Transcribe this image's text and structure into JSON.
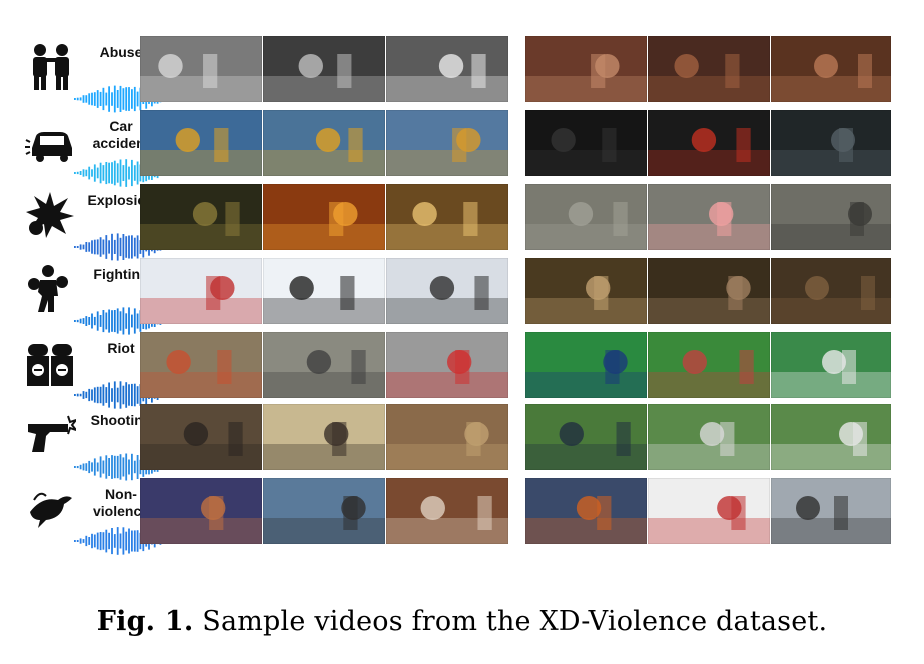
{
  "figure": {
    "rows": [
      {
        "id": "abuse",
        "label": "Abuse",
        "icon": "abuse-icon",
        "wave_color": "#1ea7ff",
        "frames": [
          {
            "bg": "#7a7a7a",
            "accent": "#d8d8d8"
          },
          {
            "bg": "#3d3d3d",
            "accent": "#bfbfbf"
          },
          {
            "bg": "#5b5b5b",
            "accent": "#eaeaea"
          },
          {
            "bg": "#6a3a2a",
            "accent": "#c48b6a"
          },
          {
            "bg": "#4a2a20",
            "accent": "#a06040"
          },
          {
            "bg": "#5a3320",
            "accent": "#b97855"
          }
        ]
      },
      {
        "id": "car-accident",
        "label": "Car accident",
        "icon": "car-crash-icon",
        "wave_color": "#28b7f0",
        "frames": [
          {
            "bg": "#3d6a98",
            "accent": "#e0a020"
          },
          {
            "bg": "#4a7398",
            "accent": "#e0a020"
          },
          {
            "bg": "#5479a0",
            "accent": "#d89a28"
          },
          {
            "bg": "#151515",
            "accent": "#333333"
          },
          {
            "bg": "#1a1a1a",
            "accent": "#c03020"
          },
          {
            "bg": "#202628",
            "accent": "#556066"
          }
        ]
      },
      {
        "id": "explosion",
        "label": "Explosion",
        "icon": "explosion-icon",
        "wave_color": "#2a6fd6",
        "frames": [
          {
            "bg": "#2a2a18",
            "accent": "#8a7a3a"
          },
          {
            "bg": "#8a3a10",
            "accent": "#f0a030"
          },
          {
            "bg": "#6a4a20",
            "accent": "#e8c070"
          },
          {
            "bg": "#7a7a70",
            "accent": "#a0a096"
          },
          {
            "bg": "#7a7a72",
            "accent": "#f0a0a0"
          },
          {
            "bg": "#6e6e66",
            "accent": "#3a3a36"
          }
        ]
      },
      {
        "id": "fighting",
        "label": "Fighting",
        "icon": "boxer-icon",
        "wave_color": "#1a7fe0",
        "frames": [
          {
            "bg": "#e6eaf0",
            "accent": "#c03030"
          },
          {
            "bg": "#eef2f6",
            "accent": "#202020"
          },
          {
            "bg": "#d8dde4",
            "accent": "#303030"
          },
          {
            "bg": "#4a3a20",
            "accent": "#c0a070"
          },
          {
            "bg": "#3a2e1c",
            "accent": "#a08060"
          },
          {
            "bg": "#443422",
            "accent": "#806040"
          }
        ]
      },
      {
        "id": "riot",
        "label": "Riot",
        "icon": "riot-police-icon",
        "wave_color": "#1a6fd0",
        "frames": [
          {
            "bg": "#8a7a60",
            "accent": "#c85030"
          },
          {
            "bg": "#8a8a80",
            "accent": "#404040"
          },
          {
            "bg": "#9a9a9a",
            "accent": "#d03030"
          },
          {
            "bg": "#2a8a40",
            "accent": "#1a3a7a"
          },
          {
            "bg": "#3a8a3a",
            "accent": "#c04040"
          },
          {
            "bg": "#3a8a4a",
            "accent": "#e8e8e8"
          }
        ]
      },
      {
        "id": "shooting",
        "label": "Shooting",
        "icon": "gun-icon",
        "wave_color": "#2a8ae0",
        "frames": [
          {
            "bg": "#5a4a38",
            "accent": "#2a2420"
          },
          {
            "bg": "#c8b890",
            "accent": "#3a3028"
          },
          {
            "bg": "#8a6a4a",
            "accent": "#c0a070"
          },
          {
            "bg": "#4a7a3a",
            "accent": "#203040"
          },
          {
            "bg": "#5a8a4a",
            "accent": "#d8d8d8"
          },
          {
            "bg": "#5a8a4a",
            "accent": "#e8e8e8"
          }
        ]
      },
      {
        "id": "non-violence",
        "label": "Non-violence",
        "icon": "dove-icon",
        "wave_color": "#2a7fe6",
        "frames": [
          {
            "bg": "#3a3a6a",
            "accent": "#c07040"
          },
          {
            "bg": "#5a7a9a",
            "accent": "#303030"
          },
          {
            "bg": "#7a4a30",
            "accent": "#e0d0c0"
          },
          {
            "bg": "#3a4a6a",
            "accent": "#d06020"
          },
          {
            "bg": "#eeeeee",
            "accent": "#c03030"
          },
          {
            "bg": "#a0a8b0",
            "accent": "#303030"
          }
        ]
      }
    ]
  },
  "caption": {
    "label": "Fig. 1.",
    "text": "Sample videos from the XD-Violence dataset."
  }
}
